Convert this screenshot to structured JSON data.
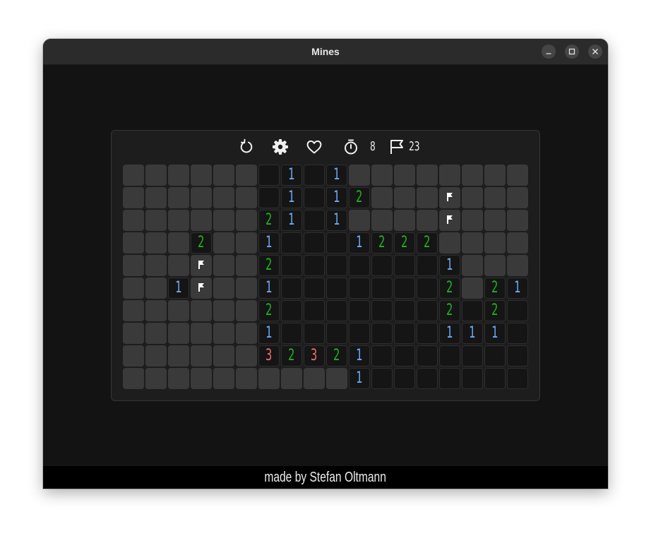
{
  "window": {
    "title": "Mines",
    "controls": [
      "minimize-icon",
      "maximize-icon",
      "close-icon"
    ]
  },
  "toolbar": {
    "buttons": [
      "restart-icon",
      "gear-icon",
      "heart-icon"
    ],
    "timer_icon": "stopwatch-icon",
    "timer_value": "8",
    "flag_icon": "flag-icon",
    "flags_value": "23"
  },
  "board": {
    "rows": 10,
    "cols": 18,
    "legend": "H = unrevealed, F = flagged, . = revealed empty, digit = revealed count",
    "cells": [
      "HHHHHH.1.1HHHHHHHH",
      "HHHHHH.1.12HHHFHHH",
      "HHHHHH21.1HHHHFHHH",
      "HHH2HH1...1222HHHH",
      "HHHFHH2.......1HHH",
      "HH1FHH1.......2H211",
      "HHHHHH2.......2.2..",
      "HHHHHH1.......111..",
      "HHHHHH32321.......",
      "HHHHHHHHHH1......."
    ]
  },
  "colors": {
    "one": "#6aaaf2",
    "two": "#1fb21f",
    "three": "#f06b6b",
    "flag": "#ffffff",
    "hidden": "#3a3a3a",
    "open": "#151515"
  },
  "footer": {
    "text": "made by Stefan Oltmann"
  }
}
